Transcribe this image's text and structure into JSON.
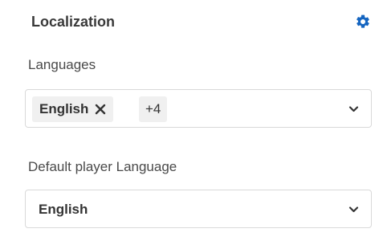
{
  "section": {
    "title": "Localization",
    "settings_icon": "gear-icon",
    "accent_color": "#1565c0"
  },
  "languages": {
    "label": "Languages",
    "chips": [
      "English"
    ],
    "more_count": "+4",
    "remove_icon": "close-icon",
    "dropdown_icon": "chevron-down-icon"
  },
  "default_language": {
    "label": "Default player Language",
    "value": "English",
    "dropdown_icon": "chevron-down-icon"
  }
}
